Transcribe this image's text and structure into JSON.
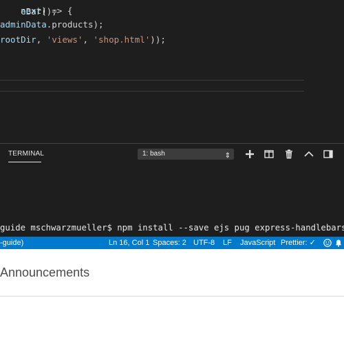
{
  "editor": {
    "cut_line_text": "eBar();",
    "line1_pre": "    ",
    "line1_param": "next",
    "line1_post": ") => {",
    "line2_fn": "adminData",
    "line2_post": ".products);",
    "line3_var": "rootDir",
    "line3_sep": ", ",
    "line3_str1": "'views'",
    "line3_str2": "'shop.html'",
    "line3_end": "));"
  },
  "panel": {
    "tab_label": "TERMINAL",
    "terminal_select": "1: bash",
    "select_arrow": "⇕",
    "toolbar_icons": [
      "plus-icon",
      "split-terminal-icon",
      "trash-icon",
      "chevron-up-icon",
      "close-panel-icon"
    ]
  },
  "terminal": {
    "prompt_text": "guide mschwarzmueller$ npm install --save ejs pug express-handlebars"
  },
  "statusbar": {
    "left_text": "-guide)",
    "position": "Ln 16, Col 1",
    "spaces": "Spaces: 2",
    "encoding": "UTF-8",
    "eol": "LF",
    "language": "JavaScript",
    "prettier": "Prettier: ✓",
    "icons": [
      "smiley-icon",
      "bell-icon"
    ]
  },
  "page": {
    "heading": "Announcements"
  }
}
